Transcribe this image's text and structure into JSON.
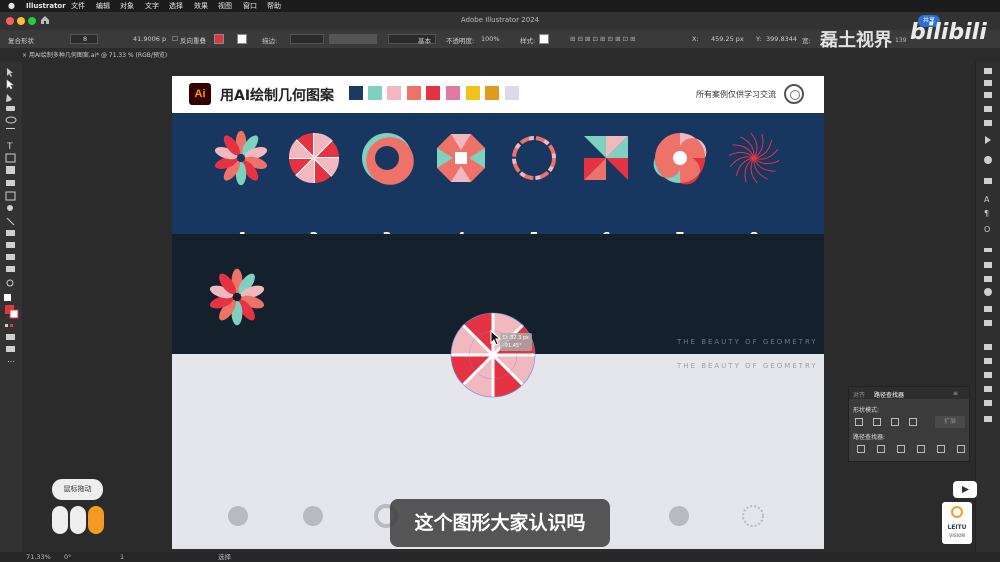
{
  "menubar": {
    "app": "Illustrator",
    "items": [
      "文件",
      "编辑",
      "对象",
      "文字",
      "选择",
      "效果",
      "视图",
      "窗口",
      "帮助"
    ]
  },
  "titlebar": {
    "title": "Adobe Illustrator 2024",
    "share_label": "共享"
  },
  "controlbar": {
    "selection_label": "复合形状",
    "x_value": "8",
    "w_small": "41.9006 p",
    "reverse_overprint": "反向重叠",
    "stroke_label": "描边:",
    "basic_label": "基本",
    "opacity_label": "不透明度:",
    "opacity_value": "100%",
    "style_label": "样式:",
    "x_label": "X:",
    "x_coord": "459.25 px",
    "y_label": "Y:",
    "y_coord": "399.8344",
    "w_label": "宽:"
  },
  "document_tab": "用AI绘制多种几何图案.ai* @ 71.33 % (RGB/预览)",
  "artboard": {
    "title": "用AI绘制几何图案",
    "note": "所有案例仅供学习交流",
    "numbers": [
      "1",
      "2",
      "3",
      "4",
      "5",
      "6",
      "7",
      "8"
    ],
    "tagline": "THE BEAUTY OF GEOMETRY",
    "palette": [
      "#1b3a63",
      "#7ed0bf",
      "#f2b8c0",
      "#ef7268",
      "#e53343",
      "#e07aa5",
      "#f0c21a",
      "#e09a1d",
      "#dcd9ea"
    ]
  },
  "tooltip": {
    "line1": "D: 32.3 px",
    "line2": "-91.45°"
  },
  "pathfinder": {
    "tab_align": "对齐",
    "tab_pathfinder": "路径查找器",
    "shape_modes": "形状模式:",
    "pathfinders": "路径查找器:",
    "expand": "扩展"
  },
  "statusbar": {
    "zoom": "71.33%",
    "rotation": "0°",
    "artboard": "1",
    "tool": "选择"
  },
  "overlay": {
    "subtitle": "这个图形大家认识吗",
    "drag_badge": "鼠标拖动",
    "watermark_text": "磊土视界",
    "bilibili": "bilibili",
    "watermark_id": "139",
    "leitu": "LEITU",
    "vision": "VISION"
  }
}
